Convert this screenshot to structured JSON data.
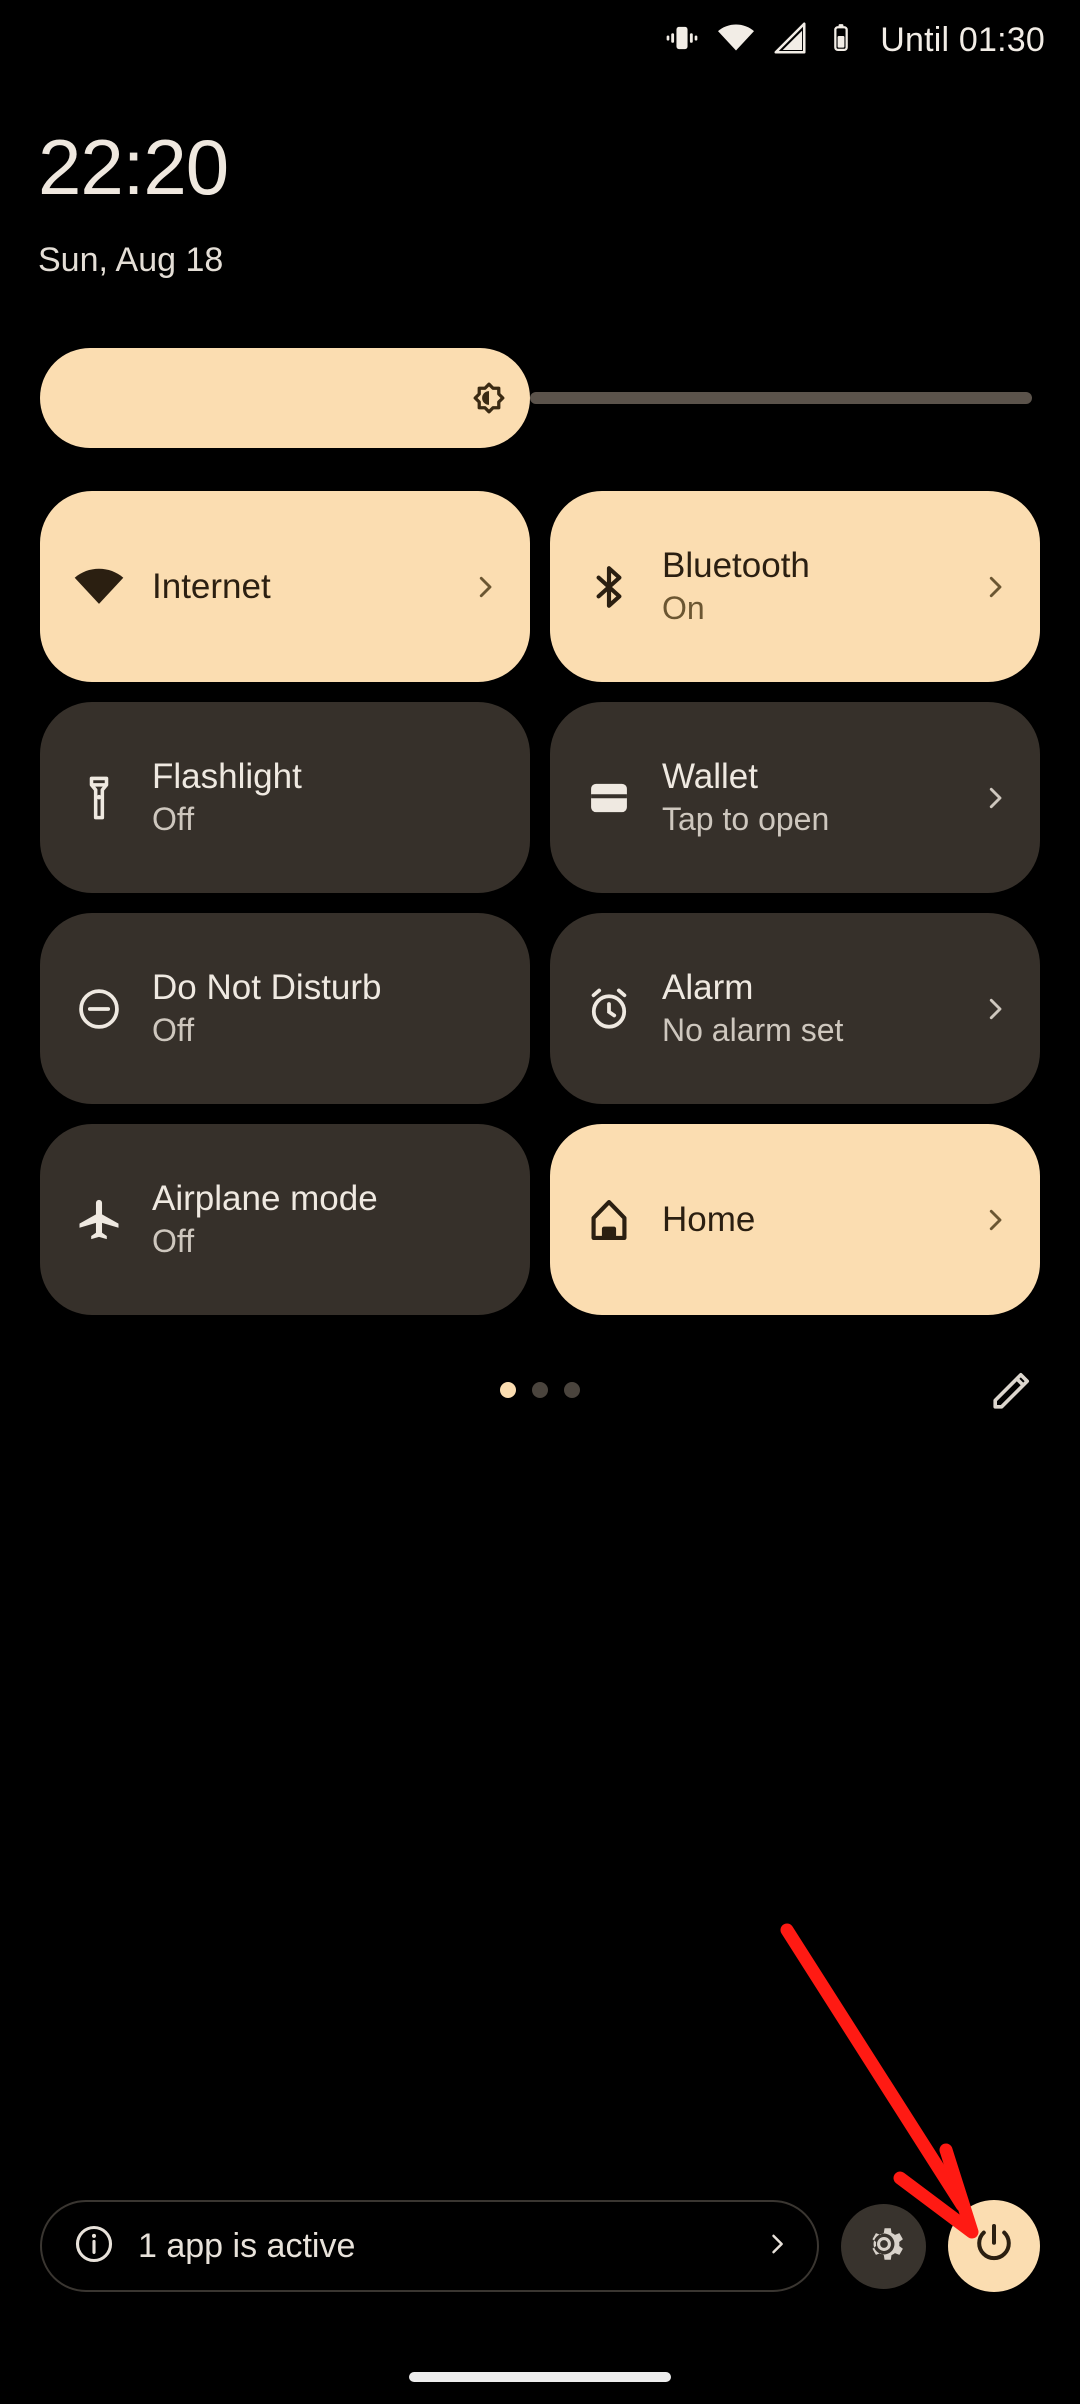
{
  "statusbar": {
    "time": "22:20",
    "date": "Sun, Aug 18",
    "battery_text": "Until 01:30",
    "icons": [
      "vibrate-icon",
      "wifi-icon",
      "signal-icon",
      "battery-icon"
    ]
  },
  "brightness": {
    "label": "Brightness",
    "icon": "auto-brightness-icon",
    "value_percent": 49
  },
  "tiles": [
    {
      "id": "internet",
      "title": "Internet",
      "subtitle": "",
      "icon": "wifi-icon",
      "state": "active",
      "chevron": true
    },
    {
      "id": "bluetooth",
      "title": "Bluetooth",
      "subtitle": "On",
      "icon": "bluetooth-icon",
      "state": "active",
      "chevron": true
    },
    {
      "id": "flashlight",
      "title": "Flashlight",
      "subtitle": "Off",
      "icon": "flashlight-icon",
      "state": "inactive",
      "chevron": false
    },
    {
      "id": "wallet",
      "title": "Wallet",
      "subtitle": "Tap to open",
      "icon": "wallet-icon",
      "state": "inactive",
      "chevron": true
    },
    {
      "id": "dnd",
      "title": "Do Not Disturb",
      "subtitle": "Off",
      "icon": "do-not-disturb-icon",
      "state": "inactive",
      "chevron": false
    },
    {
      "id": "alarm",
      "title": "Alarm",
      "subtitle": "No alarm set",
      "icon": "alarm-icon",
      "state": "inactive",
      "chevron": true
    },
    {
      "id": "airplane",
      "title": "Airplane mode",
      "subtitle": "Off",
      "icon": "airplane-icon",
      "state": "inactive",
      "chevron": false
    },
    {
      "id": "home",
      "title": "Home",
      "subtitle": "",
      "icon": "home-icon",
      "state": "active",
      "chevron": true
    }
  ],
  "pager": {
    "pages": 3,
    "current": 1,
    "edit_icon": "pencil-icon"
  },
  "bottom": {
    "apps_active_label": "1 app is active",
    "info_icon": "info-icon",
    "chevron_icon": "chevron-right-icon",
    "settings_icon": "gear-icon",
    "power_icon": "power-icon"
  },
  "colors": {
    "accent": "#FBDDB1",
    "tile_inactive": "#36302A",
    "background": "#000000",
    "annotation": "#FF1A13"
  }
}
